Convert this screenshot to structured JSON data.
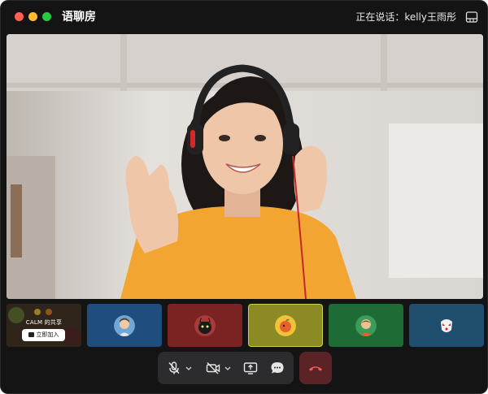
{
  "window": {
    "title": "语聊房",
    "speaking_status": "正在说话：kelly王雨彤"
  },
  "toolbar": {
    "layout_icon": "layout-icon"
  },
  "main_video": {
    "description_icon": "video-feed"
  },
  "thumbnails": {
    "share": {
      "label": "CALM 的共享",
      "join_label": "立即加入"
    },
    "participants": [
      {
        "color": "#1f4e7e",
        "avatar": "avatar-boy-icon"
      },
      {
        "color": "#7b2222",
        "avatar": "avatar-black-cat-icon"
      },
      {
        "color": "#8c8a24",
        "avatar": "avatar-orange-icon"
      },
      {
        "color": "#1f6b36",
        "avatar": "avatar-bird-icon"
      },
      {
        "color": "#1f4e6e",
        "avatar": "avatar-mask-icon"
      }
    ]
  },
  "controls": {
    "mic": "mic-muted-icon",
    "camera": "camera-off-icon",
    "share": "share-screen-icon",
    "chat": "chat-icon",
    "hangup": "hangup-icon"
  }
}
